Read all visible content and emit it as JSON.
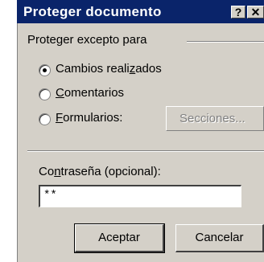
{
  "dialog": {
    "title": "Proteger documento",
    "help_button": "?",
    "close_button": "✕"
  },
  "protect_group": {
    "label": "Proteger excepto para",
    "options": [
      {
        "label": "Cambios realizados",
        "checked": true
      },
      {
        "label": "Comentarios",
        "checked": false
      },
      {
        "label": "Formularios:",
        "checked": false
      }
    ],
    "sections_button": "Secciones..."
  },
  "password": {
    "label": "Contraseña (opcional):",
    "value": "**"
  },
  "buttons": {
    "ok": "Aceptar",
    "cancel": "Cancelar"
  }
}
